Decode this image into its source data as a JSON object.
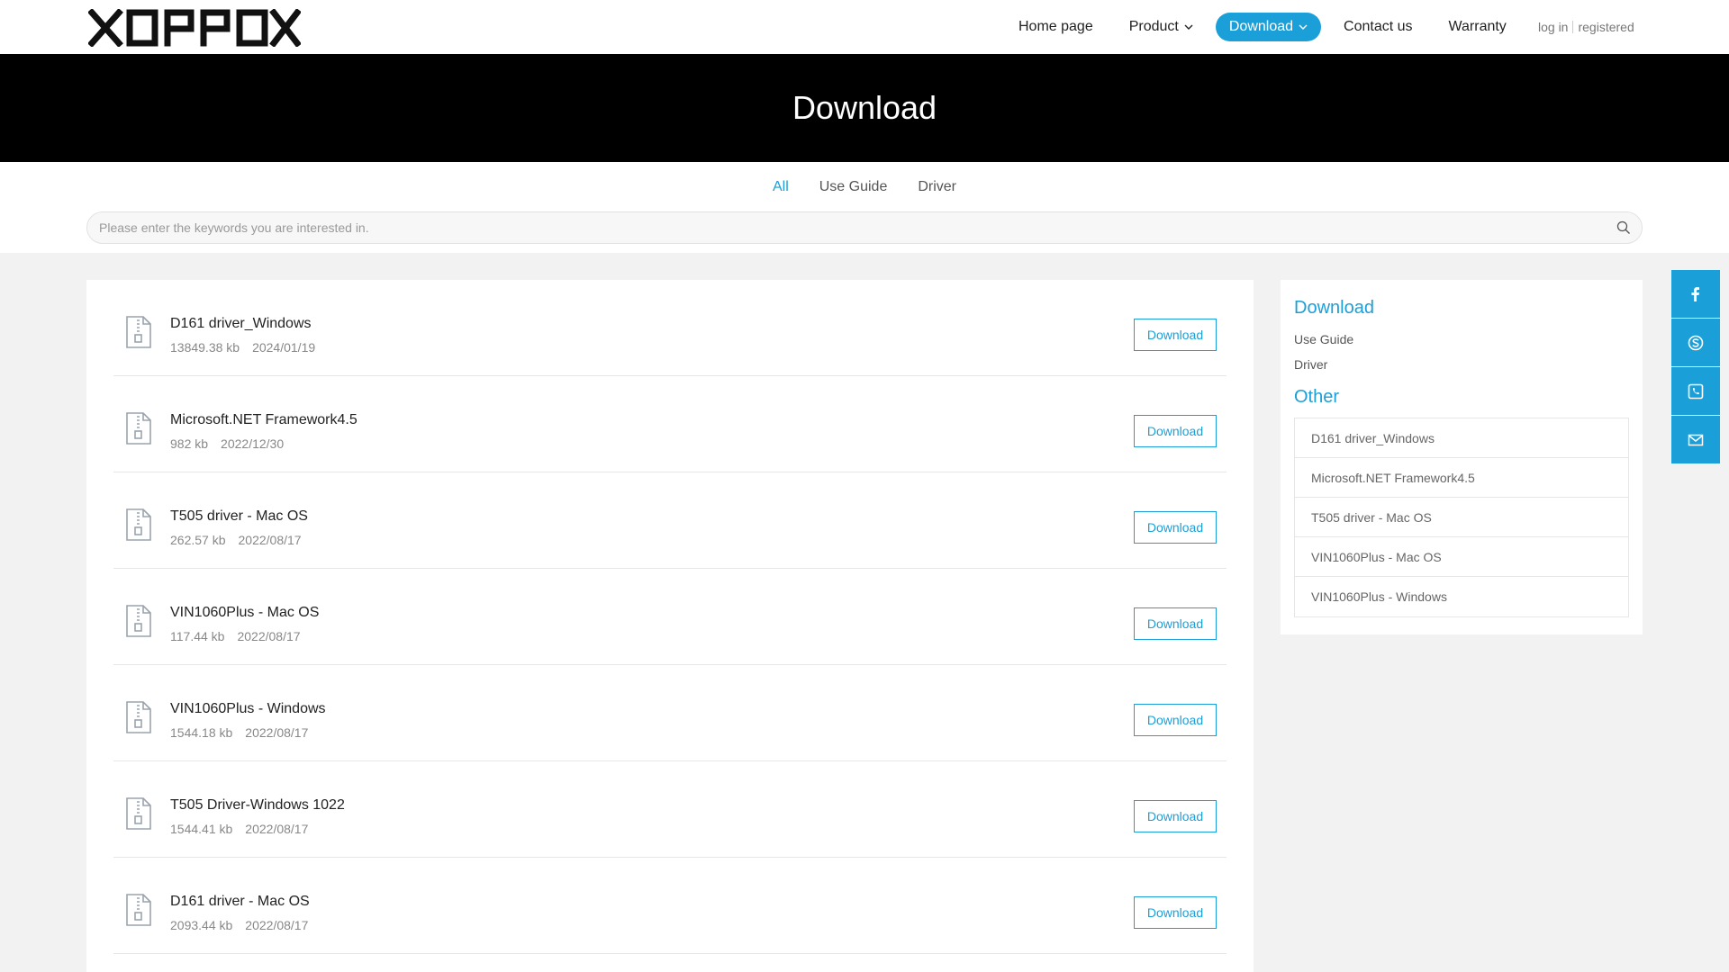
{
  "header": {
    "logo_text": "XOPPOX",
    "nav": [
      {
        "label": "Home page"
      },
      {
        "label": "Product"
      },
      {
        "label": "Download"
      },
      {
        "label": "Contact us"
      },
      {
        "label": "Warranty"
      }
    ],
    "login": "log in",
    "register": "registered"
  },
  "banner": {
    "title": "Download"
  },
  "filter": {
    "tabs": [
      {
        "label": "All",
        "active": true
      },
      {
        "label": "Use Guide"
      },
      {
        "label": "Driver"
      }
    ],
    "search_placeholder": "Please enter the keywords you are interested in."
  },
  "downloads": [
    {
      "name": "D161 driver_Windows",
      "size": "13849.38 kb",
      "date": "2024/01/19",
      "button": "Download"
    },
    {
      "name": "Microsoft.NET Framework4.5",
      "size": "982 kb",
      "date": "2022/12/30",
      "button": "Download"
    },
    {
      "name": "T505 driver - Mac OS",
      "size": "262.57 kb",
      "date": "2022/08/17",
      "button": "Download"
    },
    {
      "name": "VIN1060Plus - Mac OS",
      "size": "117.44 kb",
      "date": "2022/08/17",
      "button": "Download"
    },
    {
      "name": "VIN1060Plus - Windows",
      "size": "1544.18 kb",
      "date": "2022/08/17",
      "button": "Download"
    },
    {
      "name": "T505 Driver-Windows 1022",
      "size": "1544.41 kb",
      "date": "2022/08/17",
      "button": "Download"
    },
    {
      "name": "D161 driver - Mac OS",
      "size": "2093.44 kb",
      "date": "2022/08/17",
      "button": "Download"
    }
  ],
  "sidebar": {
    "heading": "Download",
    "links": [
      "Use Guide",
      "Driver"
    ],
    "other_heading": "Other",
    "other_items": [
      "D161 driver_Windows",
      "Microsoft.NET Framework4.5",
      "T505 driver - Mac OS",
      "VIN1060Plus - Mac OS",
      "VIN1060Plus - Windows"
    ]
  },
  "floating": {
    "icons": [
      "facebook-icon",
      "skype-icon",
      "phone-icon",
      "mail-icon"
    ]
  },
  "colors": {
    "accent": "#1a9fd9",
    "banner_bg": "#000000"
  }
}
